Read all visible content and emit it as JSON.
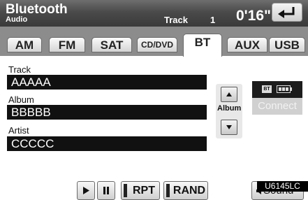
{
  "header": {
    "title": "Bluetooth",
    "subtitle": "Audio",
    "track_label": "Track",
    "track_number": "1",
    "elapsed_time": "0'16\"",
    "back_icon": "return-arrow-icon"
  },
  "tabs": [
    {
      "label": "AM",
      "active": false
    },
    {
      "label": "FM",
      "active": false
    },
    {
      "label": "SAT",
      "active": false
    },
    {
      "label": "CD/DVD",
      "active": false
    },
    {
      "label": "BT",
      "active": true
    },
    {
      "label": "AUX",
      "active": false
    },
    {
      "label": "USB",
      "active": false
    }
  ],
  "fields": {
    "track": {
      "label": "Track",
      "value": "AAAAA"
    },
    "album": {
      "label": "Album",
      "value": "BBBBB"
    },
    "artist": {
      "label": "Artist",
      "value": "CCCCC"
    }
  },
  "album_nav": {
    "label": "Album"
  },
  "status": {
    "bt_badge": "BT",
    "battery_icon": "battery-icon"
  },
  "connect_label": "Connect",
  "controls": {
    "play_icon": "play-icon",
    "pause_icon": "pause-icon",
    "repeat_label": "RPT",
    "random_label": "RAND",
    "sound_label": "Sound",
    "sound_icon": "speaker-icon"
  },
  "figure_code": "U6145LC"
}
